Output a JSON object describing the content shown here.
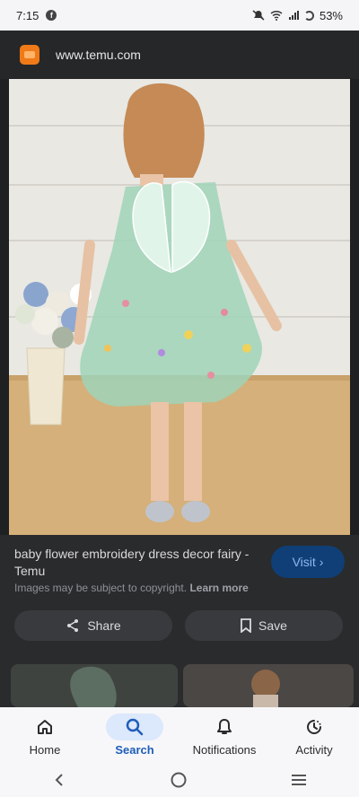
{
  "status": {
    "time": "7:15",
    "battery": "53%"
  },
  "browser": {
    "url": "www.temu.com"
  },
  "result": {
    "title": "baby flower embroidery dress decor fairy - Temu",
    "visit_label": "Visit",
    "copyright_text": "Images may be subject to copyright.",
    "learn_more": "Learn more",
    "share_label": "Share",
    "save_label": "Save"
  },
  "nav": {
    "items": [
      {
        "label": "Home",
        "icon": "home-icon"
      },
      {
        "label": "Search",
        "icon": "search-icon"
      },
      {
        "label": "Notifications",
        "icon": "bell-icon"
      },
      {
        "label": "Activity",
        "icon": "activity-icon"
      }
    ]
  },
  "colors": {
    "accent": "#1f5db8",
    "visit_button": "#0f3f76"
  }
}
